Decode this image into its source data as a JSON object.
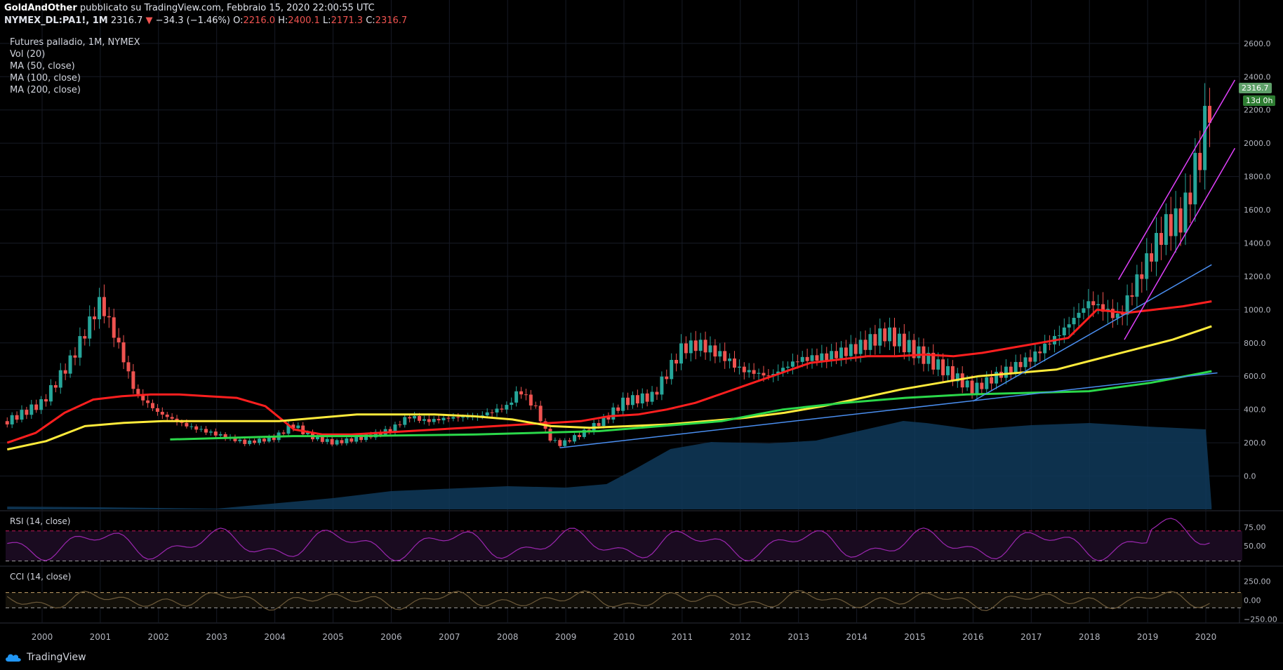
{
  "header": {
    "author": "GoldAndOther",
    "published": "pubblicato su TradingView.com, Febbraio 15, 2020 22:00:55 UTC",
    "symbol": "NYMEX_DL:PA1!, 1M",
    "last": "2316.7",
    "change": "−34.3 (−1.46%)",
    "o_label": "O:",
    "o": "2216.0",
    "h_label": "H:",
    "h": "2400.1",
    "l_label": "L:",
    "l": "2171.3",
    "c_label": "C:",
    "c": "2316.7"
  },
  "legend": {
    "title": "Futures palladio, 1M, NYMEX",
    "vol": "Vol (20)",
    "ma50": "MA (50, close)",
    "ma100": "MA (100, close)",
    "ma200": "MA (200, close)"
  },
  "price_tags": {
    "last": "2316.7",
    "countdown": "13d 0h"
  },
  "rsi_label": "RSI (14, close)",
  "cci_label": "CCI (14, close)",
  "footer": {
    "brand": "TradingView"
  },
  "colors": {
    "up": "#26a69a",
    "down": "#ef5350",
    "ma50": "#ff1f1f",
    "ma100": "#ffeb3b",
    "ma200": "#2bd84a",
    "volume": "#0f3a5a",
    "trend": "#4a8ef0",
    "channel": "#e040fb",
    "rsi": "#9c27b0"
  },
  "chart_data": [
    {
      "type": "line",
      "title": "Futures palladio, 1M, NYMEX",
      "x_ticks": [
        "2000",
        "2001",
        "2002",
        "2003",
        "2004",
        "2005",
        "2006",
        "2007",
        "2008",
        "2009",
        "2010",
        "2011",
        "2012",
        "2013",
        "2014",
        "2015",
        "2016",
        "2017",
        "2018",
        "2019",
        "2020"
      ],
      "y_ticks": [
        "0.0",
        "200.0",
        "400.0",
        "600.0",
        "800.0",
        "1000.0",
        "1200.0",
        "1400.0",
        "1600.0",
        "1800.0",
        "2000.0",
        "2200.0",
        "2400.0",
        "2600.0"
      ],
      "ylim": [
        -200,
        2650
      ],
      "x": [
        1999.4,
        2000.0,
        2000.5,
        2001.0,
        2001.3,
        2001.6,
        2002.0,
        2002.5,
        2003.0,
        2003.5,
        2004.0,
        2004.3,
        2004.6,
        2005.0,
        2005.5,
        2006.0,
        2006.3,
        2006.6,
        2007.0,
        2007.5,
        2008.0,
        2008.2,
        2008.5,
        2008.7,
        2008.9,
        2009.3,
        2009.7,
        2010.0,
        2010.5,
        2011.0,
        2011.3,
        2011.7,
        2012.0,
        2012.5,
        2013.0,
        2013.5,
        2014.0,
        2014.5,
        2015.0,
        2015.5,
        2016.0,
        2016.5,
        2017.0,
        2017.5,
        2018.0,
        2018.5,
        2019.0,
        2019.3,
        2019.6,
        2019.9,
        2020.1
      ],
      "series": [
        {
          "name": "Futures palladio",
          "values": [
            330,
            440,
            700,
            1050,
            800,
            500,
            380,
            300,
            250,
            200,
            230,
            310,
            240,
            200,
            230,
            280,
            360,
            330,
            350,
            360,
            420,
            520,
            400,
            230,
            190,
            260,
            350,
            450,
            480,
            770,
            790,
            720,
            640,
            600,
            700,
            720,
            770,
            860,
            750,
            640,
            520,
            620,
            710,
            860,
            1050,
            950,
            1300,
            1500,
            1550,
            1950,
            2316.7
          ]
        },
        {
          "name": "MA (50, close)",
          "values": [
            200,
            260,
            380,
            460,
            480,
            490,
            490,
            480,
            470,
            420,
            280,
            250,
            250,
            260,
            270,
            280,
            290,
            300,
            310,
            320,
            330,
            360,
            370,
            400,
            440,
            500,
            560,
            620,
            680,
            700,
            720,
            720,
            730,
            720,
            740,
            770,
            800,
            830,
            1000,
            980,
            1000,
            1020,
            1050
          ]
        },
        {
          "name": "MA (100, close)",
          "values": [
            160,
            210,
            300,
            320,
            330,
            330,
            330,
            330,
            350,
            370,
            370,
            370,
            360,
            340,
            300,
            290,
            300,
            310,
            330,
            350,
            380,
            420,
            470,
            520,
            560,
            600,
            620,
            640,
            700,
            760,
            820,
            900
          ]
        },
        {
          "name": "MA (200, close)",
          "values": [
            220,
            230,
            240,
            240,
            245,
            250,
            260,
            270,
            300,
            330,
            400,
            440,
            470,
            490,
            500,
            510,
            560,
            630
          ]
        }
      ],
      "annotations": [
        "trendline",
        "trendline",
        "channel-upper",
        "channel-lower"
      ]
    },
    {
      "type": "line",
      "title": "RSI (14, close)",
      "y_ticks": [
        "50.00",
        "75.00"
      ],
      "ylim": [
        25,
        95
      ]
    },
    {
      "type": "line",
      "title": "CCI (14, close)",
      "y_ticks": [
        "−250.00",
        "0.00",
        "250.00"
      ],
      "ylim": [
        -300,
        420
      ]
    }
  ]
}
